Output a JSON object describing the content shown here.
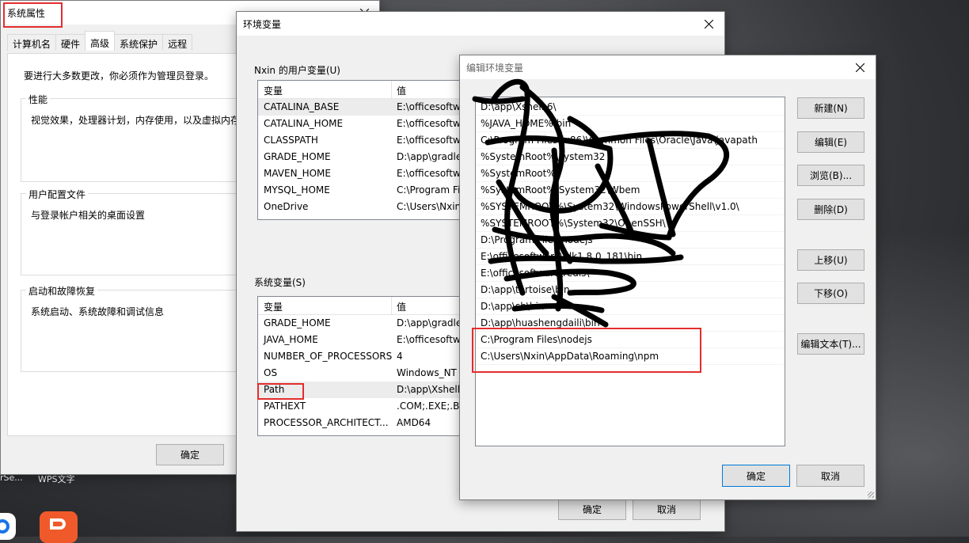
{
  "desktop": {
    "label_left": "rSe...",
    "label_wps": "WPS文字"
  },
  "sysprops": {
    "title": "系统属性",
    "tabs": [
      "计算机名",
      "硬件",
      "高级",
      "系统保护",
      "远程"
    ],
    "notice": "要进行大多数更改，你必须作为管理员登录。",
    "perf_label": "性能",
    "perf_desc": "视觉效果，处理器计划，内存使用，以及虚拟内存",
    "profile_label": "用户配置文件",
    "profile_desc": "与登录帐户相关的桌面设置",
    "startup_label": "启动和故障恢复",
    "startup_desc": "系统启动、系统故障和调试信息",
    "ok": "确定"
  },
  "envvars": {
    "title": "环境变量",
    "user_group": "Nxin 的用户变量(U)",
    "sys_group": "系统变量(S)",
    "col_var": "变量",
    "col_val": "值",
    "user_vars": [
      {
        "name": "CATALINA_BASE",
        "value": "E:\\officesoftwa"
      },
      {
        "name": "CATALINA_HOME",
        "value": "E:\\officesoftwa"
      },
      {
        "name": "CLASSPATH",
        "value": "E:\\officesoftwa"
      },
      {
        "name": "GRADE_HOME",
        "value": "D:\\app\\gradle"
      },
      {
        "name": "MAVEN_HOME",
        "value": "E:\\officesoftwa"
      },
      {
        "name": "MYSQL_HOME",
        "value": "C:\\Program Fi"
      },
      {
        "name": "OneDrive",
        "value": "C:\\Users\\Nxin"
      }
    ],
    "sys_vars": [
      {
        "name": "GRADE_HOME",
        "value": "D:\\app\\gradle"
      },
      {
        "name": "JAVA_HOME",
        "value": "E:\\officesoftwa"
      },
      {
        "name": "NUMBER_OF_PROCESSORS",
        "value": "4"
      },
      {
        "name": "OS",
        "value": "Windows_NT"
      },
      {
        "name": "Path",
        "value": "D:\\app\\Xshell"
      },
      {
        "name": "PATHEXT",
        "value": ".COM;.EXE;.BA"
      },
      {
        "name": "PROCESSOR_ARCHITECT...",
        "value": "AMD64"
      }
    ],
    "ok": "确定",
    "cancel": "取消"
  },
  "editenv": {
    "title": "编辑环境变量",
    "entries": [
      "D:\\app\\Xshell 6\\",
      "%JAVA_HOME%\\bin",
      "C:\\Program Files (x86)\\Common Files\\Oracle\\Java\\javapath",
      "%SystemRoot%\\system32",
      "%SystemRoot%",
      "%SystemRoot%\\System32\\Wbem",
      "%SYSTEMROOT%\\System32\\WindowsPowerShell\\v1.0\\",
      "%SYSTEMROOT%\\System32\\OpenSSH\\",
      "D:\\Program Files\\nodejs",
      "E:\\officesoftware\\jdk1.8.0_181\\bin",
      "E:\\officesoftware\\redis\\",
      "D:\\app\\tortoise\\bin",
      "D:\\app\\sh\\bin",
      "D:\\app\\huashengdaili\\bin",
      "C:\\Program Files\\nodejs",
      "C:\\Users\\Nxin\\AppData\\Roaming\\npm"
    ],
    "buttons": {
      "new": "新建(N)",
      "edit": "编辑(E)",
      "browse": "浏览(B)...",
      "delete": "删除(D)",
      "up": "上移(U)",
      "down": "下移(O)",
      "edit_text": "编辑文本(T)..."
    },
    "ok": "确定",
    "cancel": "取消"
  }
}
